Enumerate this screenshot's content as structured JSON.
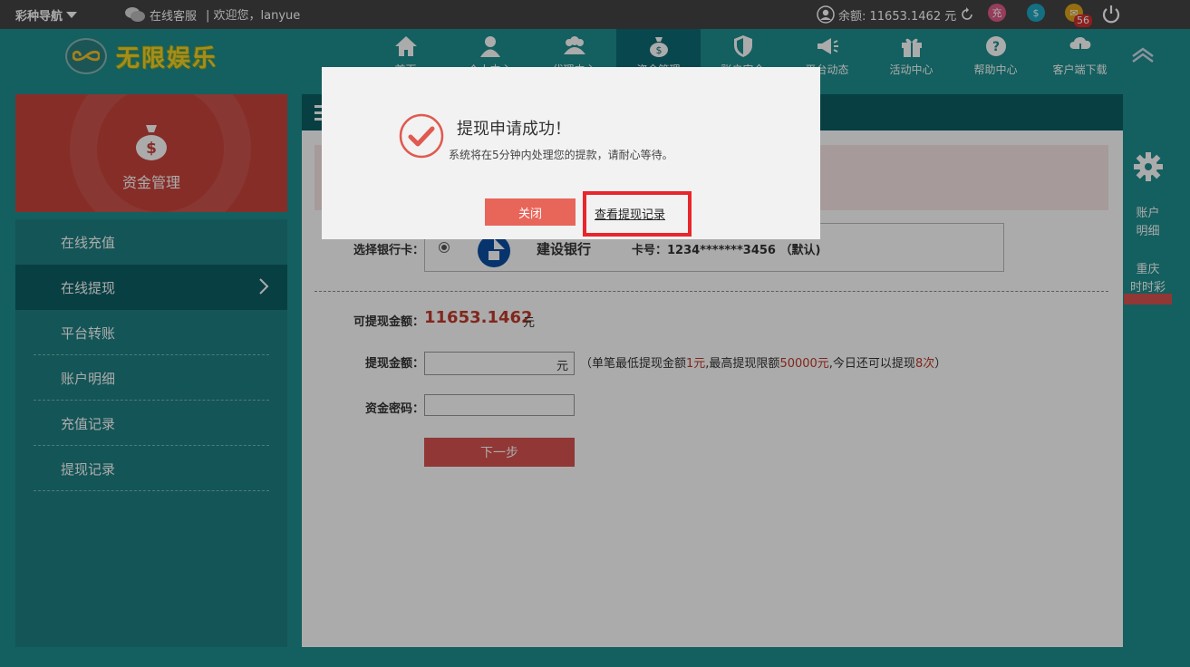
{
  "topbar": {
    "nav_label": "彩种导航",
    "service_label": "在线客服",
    "welcome": "| 欢迎您，lanyue",
    "balance_label": "余额: 11653.1462 元",
    "recharge_icon_text": "充",
    "message_badge": "56",
    "colors": {
      "recharge": "#e05a8a",
      "money": "#1ba7c2",
      "mail": "#e0a51a"
    }
  },
  "header": {
    "logo_text": "无限娱乐",
    "nav": [
      {
        "label": "首页",
        "icon": "home-icon"
      },
      {
        "label": "个人中心",
        "icon": "user-icon"
      },
      {
        "label": "代理中心",
        "icon": "users-icon"
      },
      {
        "label": "资金管理",
        "icon": "money-bag-icon"
      },
      {
        "label": "账户安全",
        "icon": "shield-icon"
      },
      {
        "label": "平台动态",
        "icon": "megaphone-icon"
      },
      {
        "label": "活动中心",
        "icon": "gift-icon"
      },
      {
        "label": "帮助中心",
        "icon": "help-icon"
      },
      {
        "label": "客户端下载",
        "icon": "download-icon"
      }
    ]
  },
  "sidebar": {
    "card_title": "资金管理",
    "items": [
      {
        "label": "在线充值"
      },
      {
        "label": "在线提现"
      },
      {
        "label": "平台转账"
      },
      {
        "label": "账户明细"
      },
      {
        "label": "充值记录"
      },
      {
        "label": "提现记录"
      }
    ]
  },
  "form": {
    "bank_label": "选择银行卡：",
    "bank_name": "建设银行",
    "card_no": "卡号：1234*******3456 （默认)",
    "available_label": "可提现金额：",
    "available_value": "11653.1462",
    "available_unit": "元",
    "amount_label": "提现金额：",
    "amount_unit": "元",
    "hint_prefix": "（单笔最低提现金额",
    "hint_min": "1元",
    "hint_mid": ",最高提现限额",
    "hint_max": "50000元",
    "hint_mid2": ",今日还可以提现",
    "hint_times": "8次",
    "hint_suffix": "）",
    "password_label": "资金密码：",
    "next_label": "下一步"
  },
  "right_tools": {
    "account_label_1": "账户",
    "account_label_2": "明细",
    "lottery_label_1": "重庆",
    "lottery_label_2": "时时彩"
  },
  "dialog": {
    "title": "提现申请成功！",
    "message": "系统将在5分钟内处理您的提款，请耐心等待。",
    "close_label": "关闭",
    "view_label": "查看提现记录"
  }
}
